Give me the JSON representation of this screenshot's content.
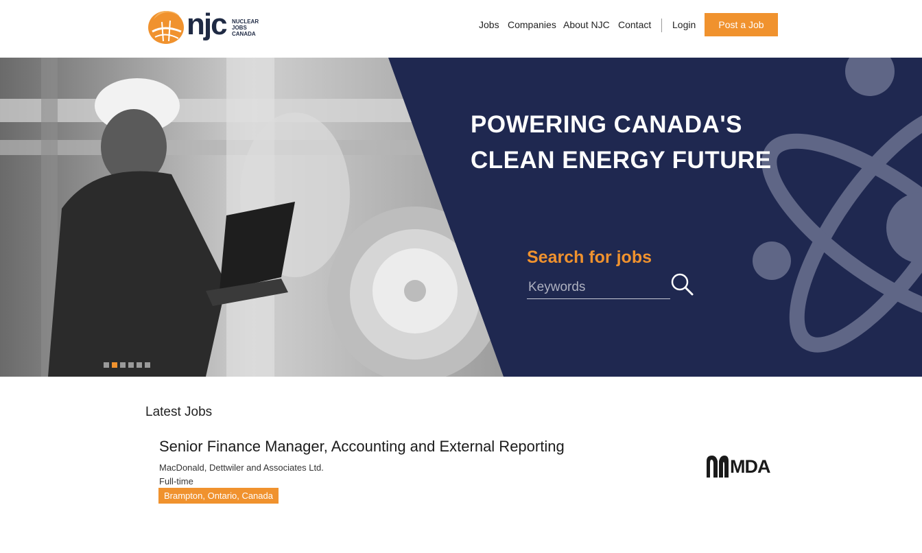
{
  "header": {
    "logo": {
      "letters": "njc",
      "sub_lines": [
        "NUCLEAR",
        "JOBS",
        "CANADA"
      ]
    },
    "nav": [
      {
        "label": "Jobs"
      },
      {
        "label": "Companies"
      },
      {
        "label": "About NJC"
      },
      {
        "label": "Contact"
      },
      {
        "label": "Login"
      }
    ],
    "post_button": "Post a Job"
  },
  "hero": {
    "title_lines": [
      "POWERING CANADA'S",
      "CLEAN ENERGY FUTURE"
    ],
    "search_label": "Search for jobs",
    "search_placeholder": "Keywords",
    "slider_dots": 6,
    "active_dot": 2
  },
  "latest_jobs": {
    "title": "Latest Jobs",
    "jobs": [
      {
        "title": "Senior Finance Manager, Accounting and External Reporting",
        "company": "MacDonald, Dettwiler and Associates Ltd.",
        "type": "Full-time",
        "location": "Brampton, Ontario, Canada",
        "company_logo_text": "MDA"
      }
    ]
  },
  "colors": {
    "accent": "#f0922e",
    "navy": "#1f2850",
    "atom": "#5f6686"
  },
  "icons": [
    "njc-logo-icon",
    "search-icon",
    "mda-logo-icon"
  ]
}
